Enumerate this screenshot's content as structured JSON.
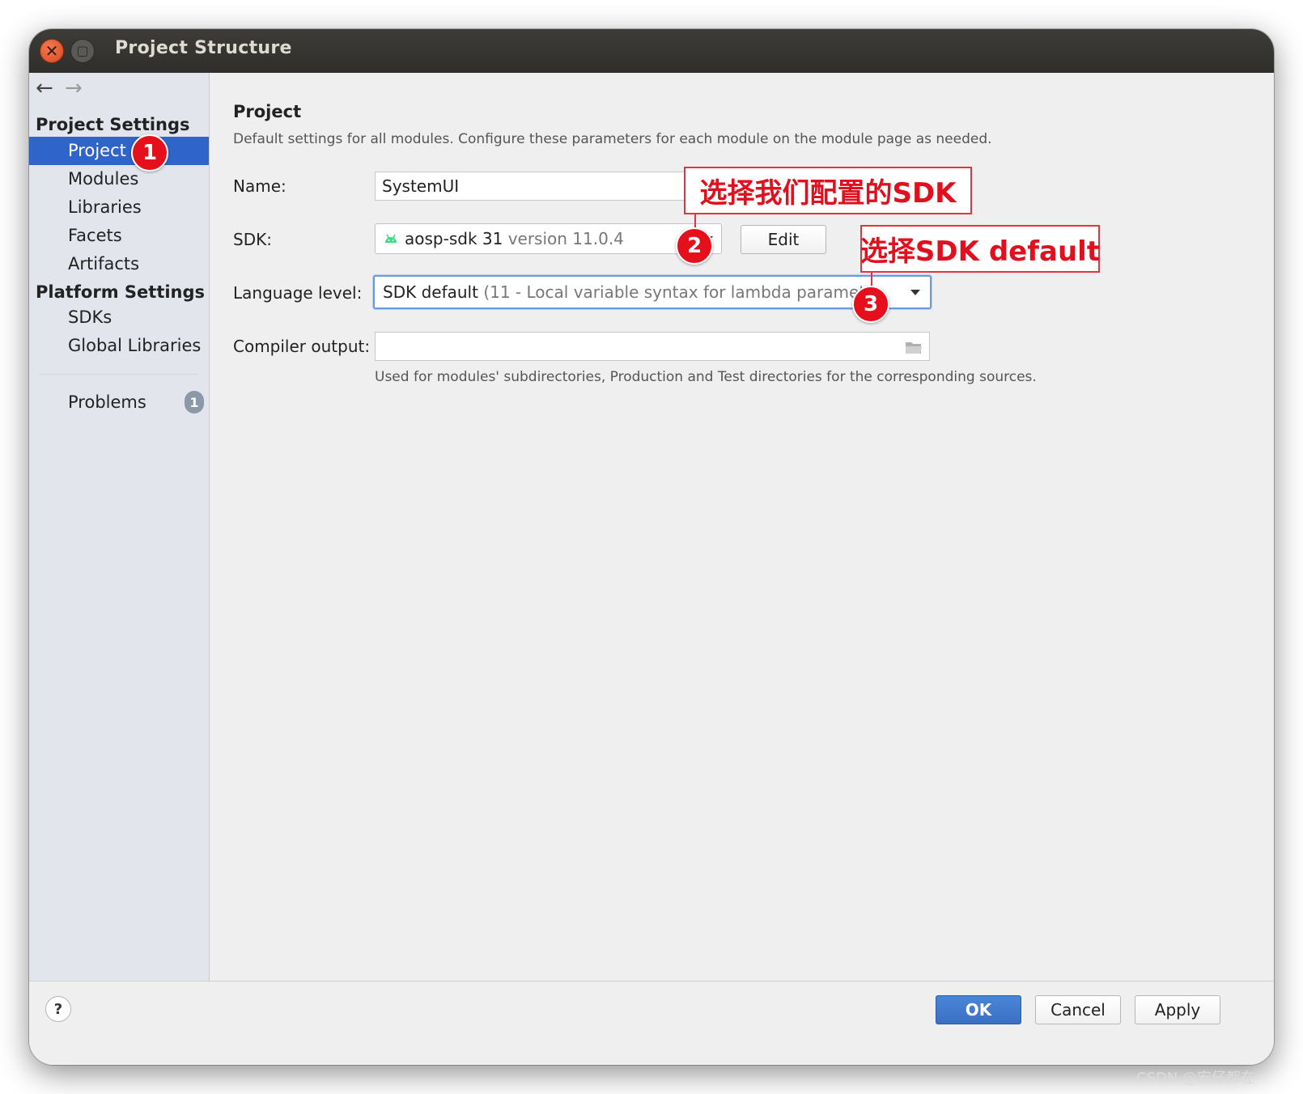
{
  "window": {
    "title": "Project Structure"
  },
  "nav": {
    "back_icon": "←",
    "forward_icon": "→"
  },
  "sidebar": {
    "project_settings_header": "Project Settings",
    "project_items": [
      "Project",
      "Modules",
      "Libraries",
      "Facets",
      "Artifacts"
    ],
    "platform_settings_header": "Platform Settings",
    "platform_items": [
      "SDKs",
      "Global Libraries"
    ],
    "problems_label": "Problems",
    "problems_count": "1",
    "selected": "Project"
  },
  "content": {
    "title": "Project",
    "description": "Default settings for all modules. Configure these parameters for each module on the module page as needed.",
    "name_label": "Name:",
    "name_value": "SystemUI",
    "sdk_label": "SDK:",
    "sdk_name": "aosp-sdk 31",
    "sdk_version": "version 11.0.4",
    "edit_button": "Edit",
    "language_level_label": "Language level:",
    "language_level_value": "SDK default",
    "language_level_detail": "(11 - Local variable syntax for lambda paramet",
    "compiler_output_label": "Compiler output:",
    "compiler_output_value": "",
    "compiler_output_hint": "Used for modules' subdirectories, Production and Test directories for the corresponding sources."
  },
  "footer": {
    "help_label": "?",
    "ok_button": "OK",
    "cancel_button": "Cancel",
    "apply_button": "Apply"
  },
  "annotations": {
    "badge1": "1",
    "badge2": "2",
    "badge3": "3",
    "note_sdk": "选择我们配置的SDK",
    "note_level": "选择SDK default"
  },
  "watermark": "CSDN @安仔都在",
  "colors": {
    "selection": "#2f65ca",
    "annotation_red": "#e5101c",
    "ok_button": "#3a70c2",
    "android_green": "#3ddc84"
  }
}
